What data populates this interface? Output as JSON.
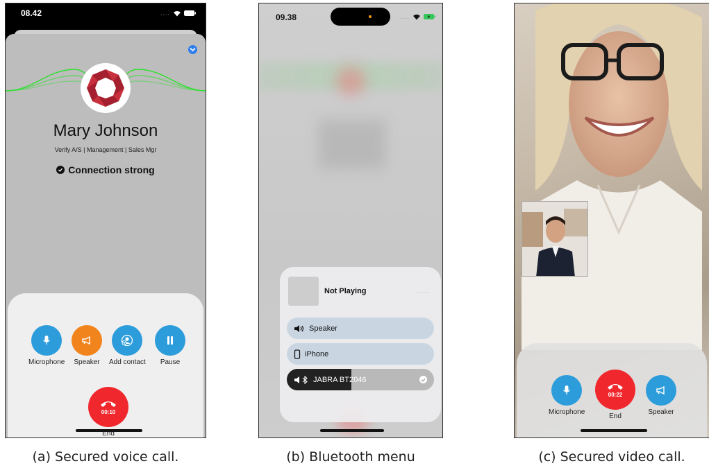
{
  "panel_a": {
    "status_time": "08.42",
    "contact_name": "Mary Johnson",
    "contact_subtitle": "Verify A/S | Management | Sales Mgr",
    "connection_status": "Connection strong",
    "controls": [
      {
        "label": "Microphone",
        "icon": "microphone-icon",
        "color": "#2d9cdb"
      },
      {
        "label": "Speaker",
        "icon": "megaphone-icon",
        "color": "#f2841e"
      },
      {
        "label": "Add contact",
        "icon": "add-contact-icon",
        "color": "#2d9cdb"
      },
      {
        "label": "Pause",
        "icon": "pause-icon",
        "color": "#2d9cdb"
      }
    ],
    "end_timer": "00:10",
    "end_label": "End",
    "end_color": "#f0282d",
    "wave_color": "#2ee02e",
    "caption": "(a) Secured voice call."
  },
  "panel_b": {
    "status_time": "09.38",
    "now_playing": "Not Playing",
    "routes": [
      {
        "label": "Speaker",
        "icon": "speaker-icon",
        "selected": false
      },
      {
        "label": "iPhone",
        "icon": "iphone-icon",
        "selected": false
      },
      {
        "label": "JABRA BT2046",
        "icon": "bluetooth-icon",
        "selected": true,
        "volume": 0.44
      }
    ],
    "caption": "(b) Bluetooth menu"
  },
  "panel_c": {
    "controls": [
      {
        "label": "Microphone",
        "icon": "microphone-icon",
        "color": "#2d9cdb"
      },
      {
        "label": "End",
        "icon": "phone-hangup-icon",
        "color": "#f0282d"
      },
      {
        "label": "Speaker",
        "icon": "megaphone-icon",
        "color": "#2d9cdb"
      }
    ],
    "end_timer": "00:22",
    "caption": "(c) Secured video call."
  }
}
